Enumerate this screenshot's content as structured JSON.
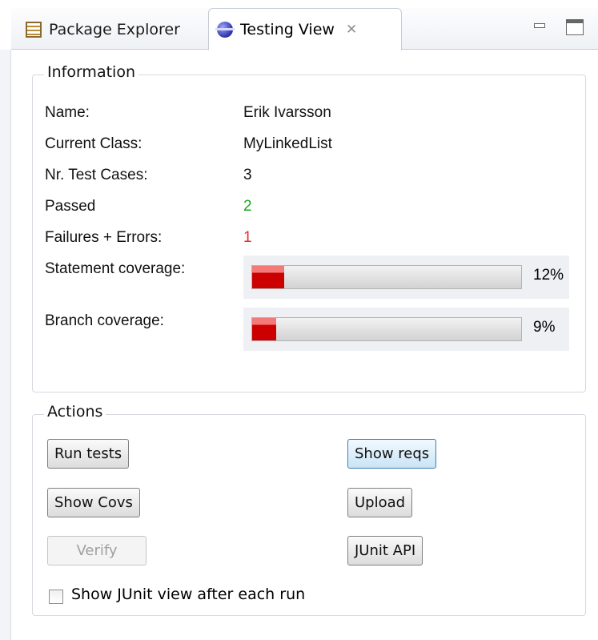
{
  "tabs": {
    "package_explorer": "Package Explorer",
    "testing_view": "Testing View"
  },
  "information": {
    "legend": "Information",
    "name_label": "Name:",
    "name_value": "Erik Ivarsson",
    "class_label": "Current Class:",
    "class_value": "MyLinkedList",
    "cases_label": "Nr. Test Cases:",
    "cases_value": "3",
    "passed_label": "Passed",
    "passed_value": "2",
    "failures_label": "Failures + Errors:",
    "failures_value": "1",
    "statement_label": "Statement coverage:",
    "statement_percent": "12%",
    "statement_fraction": 0.12,
    "branch_label": "Branch coverage:",
    "branch_percent": "9%",
    "branch_fraction": 0.09
  },
  "actions": {
    "legend": "Actions",
    "run_tests": "Run tests",
    "show_reqs": "Show reqs",
    "show_covs": "Show Covs",
    "upload": "Upload",
    "verify": "Verify",
    "junit_api": "JUnit API",
    "show_junit_checkbox": "Show JUnit view after each run",
    "show_junit_checked": false
  },
  "colors": {
    "passed": "#1aa71a",
    "failures": "#e53030",
    "coverage_bar": "#cc0000",
    "highlight_button": "#3c7fb1"
  }
}
